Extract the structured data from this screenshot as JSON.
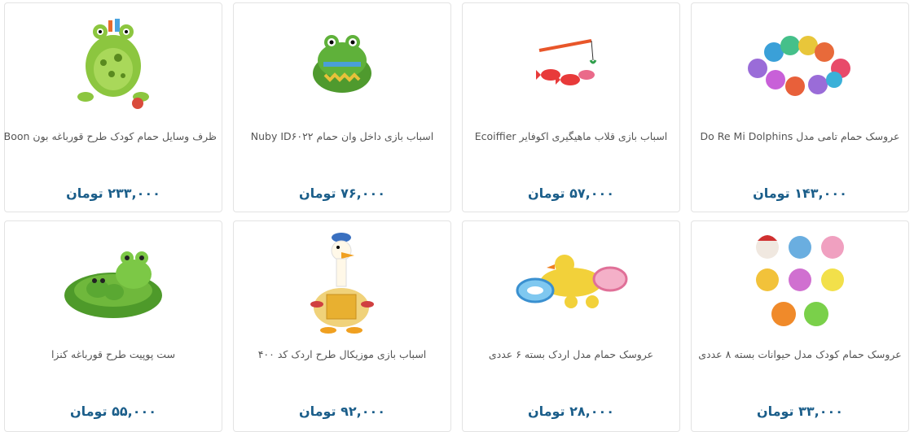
{
  "products": [
    {
      "title": "ظرف وسایل حمام کودک طرح قورباغه بون Boon",
      "price": "۲۳۳,۰۰۰ تومان",
      "icon": "frog-caddy-icon"
    },
    {
      "title": "اسباب بازی داخل وان حمام Nuby ID۶۰۲۲",
      "price": "۷۶,۰۰۰ تومان",
      "icon": "crocodile-toy-icon"
    },
    {
      "title": "اسباب بازی قلاب ماهیگیری اکوفایر Ecoiffier",
      "price": "۵۷,۰۰۰ تومان",
      "icon": "fishing-rod-icon"
    },
    {
      "title": "عروسک حمام تامی مدل Do Re Mi Dolphins",
      "price": "۱۴۳,۰۰۰ تومان",
      "icon": "dolphins-ring-icon"
    },
    {
      "title": "ست پوپیت طرح قورباغه کنزا",
      "price": "۵۵,۰۰۰ تومان",
      "icon": "frog-set-icon"
    },
    {
      "title": "اسباب بازی موزیکال طرح اردک کد ۴۰۰",
      "price": "۹۲,۰۰۰ تومان",
      "icon": "musical-duck-icon"
    },
    {
      "title": "عروسک حمام مدل اردک بسته ۶ عددی",
      "price": "۲۸,۰۰۰ تومان",
      "icon": "ducks-pack-icon"
    },
    {
      "title": "عروسک حمام کودک مدل حیوانات بسته ۸ عددی",
      "price": "۳۳,۰۰۰ تومان",
      "icon": "animals-pack-icon"
    }
  ]
}
